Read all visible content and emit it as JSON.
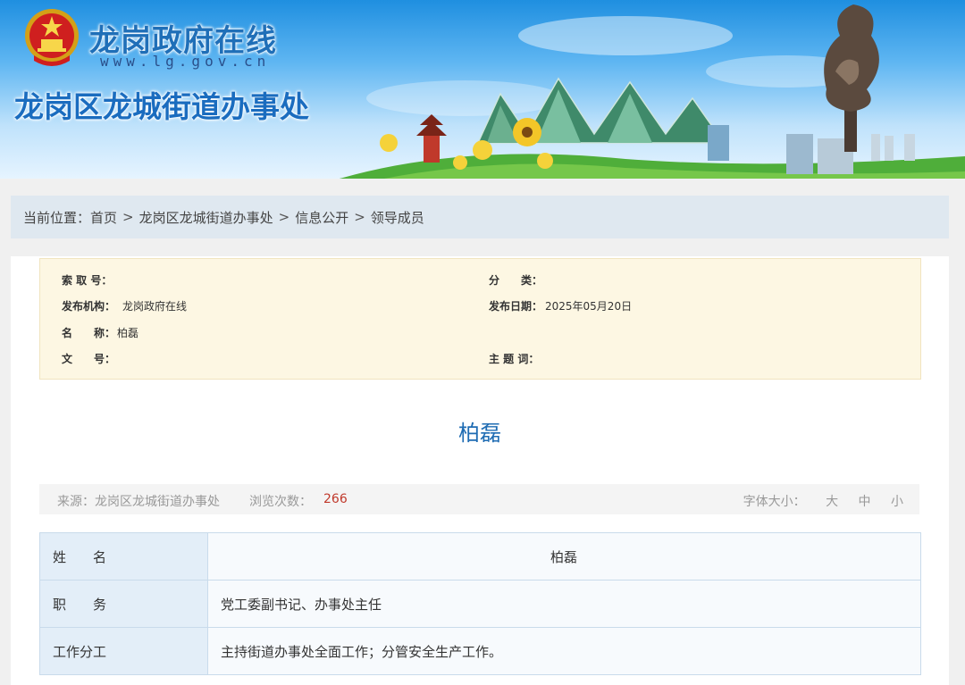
{
  "header": {
    "site_title": "龙岗政府在线",
    "site_url": "www.lg.gov.cn",
    "dept_title": "龙岗区龙城街道办事处"
  },
  "breadcrumb": {
    "prefix": "当前位置：",
    "items": [
      "首页",
      "龙岗区龙城街道办事处",
      "信息公开",
      "领导成员"
    ]
  },
  "meta": {
    "index_no_label": "索 取 号：",
    "index_no": "",
    "category_label": "分　　类：",
    "category": "",
    "publisher_label": "发布机构：",
    "publisher": "龙岗政府在线",
    "date_label": "发布日期：",
    "date": "2025年05月20日",
    "name_label": "名　　称：",
    "name": "柏磊",
    "doc_no_label": "文　　号：",
    "doc_no": "",
    "keywords_label": "主 题 词：",
    "keywords": ""
  },
  "article": {
    "title": "柏磊"
  },
  "info": {
    "source_label": "来源：",
    "source": "龙岗区龙城街道办事处",
    "views_label": "浏览次数：",
    "views": "266",
    "font_label": "字体大小：",
    "font_large": "大",
    "font_medium": "中",
    "font_small": "小"
  },
  "leader": {
    "rows": [
      {
        "key": "姓　　名",
        "value": "柏磊"
      },
      {
        "key": "职　　务",
        "value": "党工委副书记、办事处主任"
      },
      {
        "key": "工作分工",
        "value": "主持街道办事处全面工作；分管安全生产工作。"
      }
    ]
  },
  "colors": {
    "accent": "#1f6cb3",
    "count": "#c0392b",
    "meta_bg": "#fdf7e3"
  }
}
